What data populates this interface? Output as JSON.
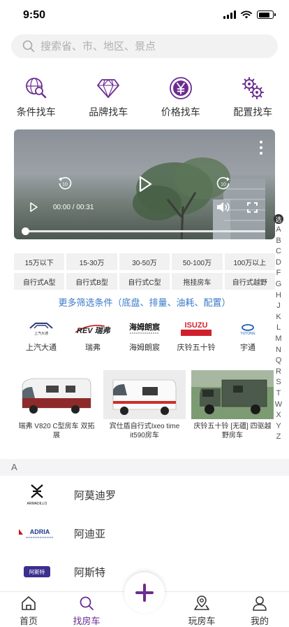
{
  "status": {
    "time": "9:50"
  },
  "search": {
    "placeholder": "搜索省、市、地区、景点"
  },
  "quick_nav": [
    {
      "label": "条件找车",
      "icon": "search-globe-icon"
    },
    {
      "label": "品牌找车",
      "icon": "diamond-icon"
    },
    {
      "label": "价格找车",
      "icon": "yen-icon"
    },
    {
      "label": "配置找车",
      "icon": "gears-icon"
    }
  ],
  "video": {
    "time": "00:00 / 00:31",
    "rewind_seconds": "10",
    "forward_seconds": "10",
    "progress": 0
  },
  "alpha_index": {
    "selected": "选",
    "letters": [
      "A",
      "B",
      "C",
      "D",
      "F",
      "G",
      "H",
      "J",
      "K",
      "L",
      "M",
      "N",
      "Q",
      "R",
      "S",
      "T",
      "W",
      "X",
      "Y",
      "Z"
    ]
  },
  "filters": [
    "15万以下",
    "15-30万",
    "30-50万",
    "50-100万",
    "100万以上",
    "自行式A型",
    "自行式B型",
    "自行式C型",
    "拖挂房车",
    "自行式越野"
  ],
  "more_filters": "更多筛选条件（底盘、排量、油耗、配置）",
  "brands": [
    {
      "name": "上汽大通",
      "logo_text": "上汽大通"
    },
    {
      "name": "瑞弗",
      "logo_text": "REV 瑞弗"
    },
    {
      "name": "海姆朗宸",
      "logo_text": "海姆朗宸"
    },
    {
      "name": "庆铃五十铃",
      "logo_text": "ISUZU"
    },
    {
      "name": "宇通",
      "logo_text": "YUTONG"
    }
  ],
  "cars": [
    {
      "title": "瑞弗 V820 C型房车 双拓展"
    },
    {
      "title": "宾仕盾自行式Ixeo time it590房车"
    },
    {
      "title": "庆铃五十铃 [无疆] 四驱越野房车"
    }
  ],
  "section_letter": "A",
  "brand_list": [
    {
      "name": "阿莫迪罗",
      "logo_text": "ARMADILLO"
    },
    {
      "name": "阿迪亚",
      "logo_text": "ADRIA"
    },
    {
      "name": "阿斯特",
      "logo_text": "阿斯特"
    }
  ],
  "tabs": [
    {
      "label": "首页"
    },
    {
      "label": "找房车"
    },
    {
      "label": "玩房车"
    },
    {
      "label": "我的"
    }
  ],
  "colors": {
    "accent": "#6b2c91",
    "link": "#3a7bc8",
    "isuzu_red": "#d0202e"
  }
}
